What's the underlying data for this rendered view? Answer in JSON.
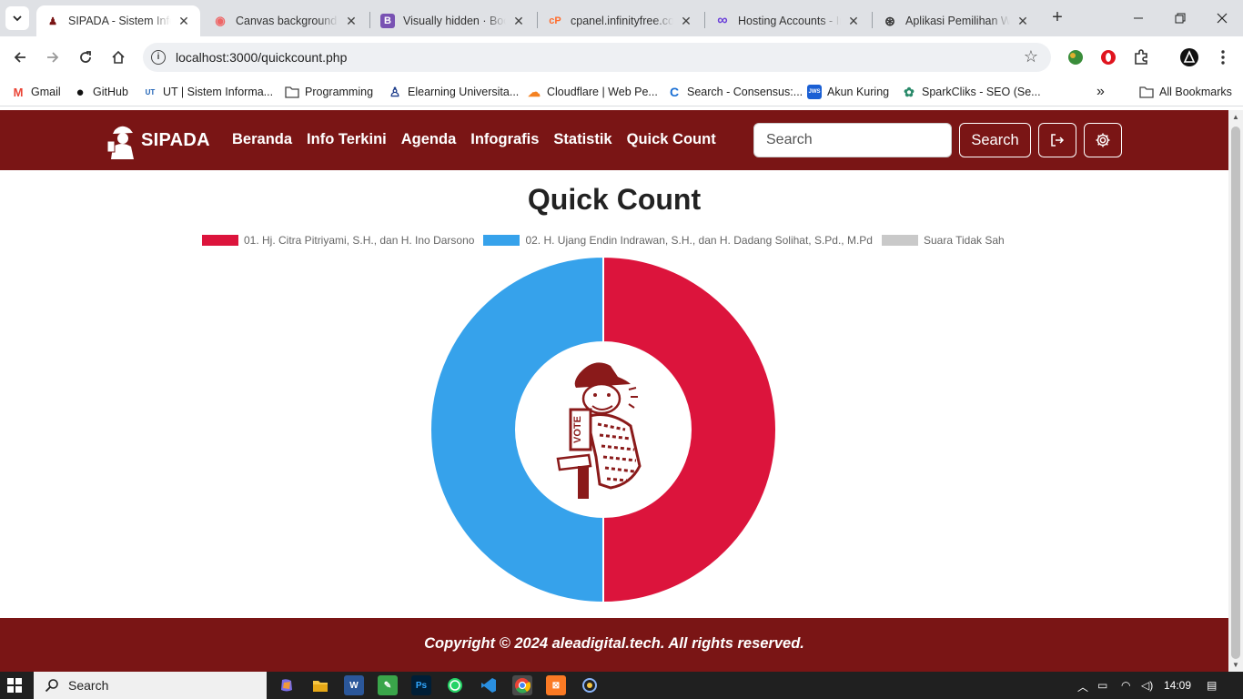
{
  "browser": {
    "tabs": [
      {
        "title": "SIPADA - Sistem Informasi",
        "favicon": "sipada-logo-icon",
        "active": true
      },
      {
        "title": "Canvas background |",
        "favicon": "mdn-icon"
      },
      {
        "title": "Visually hidden · Bootstrap",
        "favicon": "bootstrap-icon",
        "fav_text": "B"
      },
      {
        "title": "cpanel.infinityfree.com",
        "favicon": "cpanel-icon",
        "fav_text": "cP"
      },
      {
        "title": "Hosting Accounts - InfinityFree",
        "favicon": "infinity-icon",
        "fav_text": "∞"
      },
      {
        "title": "Aplikasi Pemilihan Web",
        "favicon": "openai-icon",
        "fav_text": "⊛"
      }
    ],
    "new_tab_label": "+",
    "url": "localhost:3000/quickcount.php",
    "bookmarks": [
      {
        "label": "Gmail",
        "icon": "gmail-icon",
        "icon_text": "M"
      },
      {
        "label": "GitHub",
        "icon": "github-icon",
        "icon_text": "●"
      },
      {
        "label": "UT | Sistem Informa...",
        "icon": "ut-icon",
        "icon_text": "UT"
      },
      {
        "label": "Programming",
        "icon": "folder-icon",
        "icon_text": "▭"
      },
      {
        "label": "Elearning Universita...",
        "icon": "elearning-icon",
        "icon_text": "♙"
      },
      {
        "label": "Cloudflare | Web Pe...",
        "icon": "cloudflare-icon",
        "icon_text": "☁"
      },
      {
        "label": "Search - Consensus:...",
        "icon": "consensus-icon",
        "icon_text": "C"
      },
      {
        "label": "Akun Kuring",
        "icon": "jws-icon",
        "icon_text": "JWS"
      },
      {
        "label": "SparkCliks - SEO (Se...",
        "icon": "sparkcliks-icon",
        "icon_text": "✿"
      }
    ],
    "overflow_label": "»",
    "all_bookmarks_label": "All Bookmarks"
  },
  "site": {
    "brand": "SIPADA",
    "menu": [
      "Beranda",
      "Info Terkini",
      "Agenda",
      "Infografis",
      "Statistik",
      "Quick Count"
    ],
    "search_placeholder": "Search",
    "search_button": "Search",
    "page_title": "Quick Count",
    "footer": "Copyright © 2024 aleadigital.tech. All rights reserved."
  },
  "chart_data": {
    "type": "pie",
    "variant": "doughnut",
    "categories": [
      "01. Hj. Citra Pitriyami, S.H., dan H. Ino Darsono",
      "02. H. Ujang Endin Indrawan, S.H., dan H. Dadang Solihat, S.Pd., M.Pd",
      "Suara Tidak Sah"
    ],
    "values": [
      50,
      50,
      0
    ],
    "colors": [
      "#dc143c",
      "#36a2eb",
      "#c9c9c9"
    ],
    "legend_position": "top",
    "center_image": "vote-mascot-icon"
  },
  "taskbar": {
    "search_label": "Search",
    "apps": [
      "copilot-icon",
      "file-explorer-icon",
      "word-icon",
      "notepad-icon",
      "photoshop-icon",
      "whatsapp-icon",
      "vscode-icon",
      "chrome-icon",
      "xampp-icon",
      "app-icon"
    ],
    "time": "14:09"
  }
}
